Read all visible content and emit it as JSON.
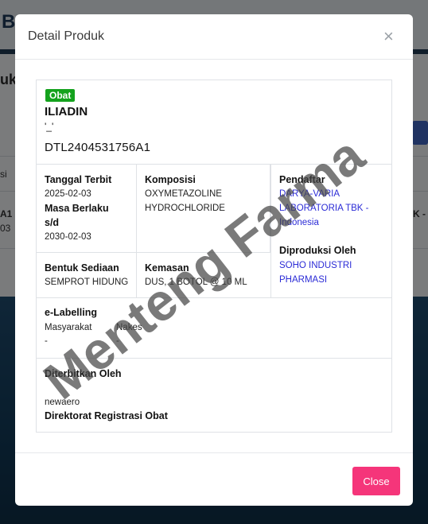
{
  "background": {
    "logo_text": "B",
    "page_title": "uk",
    "col_header": "si",
    "row_left_1": "A1",
    "row_left_2": "03",
    "row_right": "K -"
  },
  "modal": {
    "title": "Detail Produk",
    "close_icon": "close-icon",
    "badge": "Obat",
    "product_name": "ILIADIN",
    "product_sub": "'_'",
    "registration_no": "DTL2404531756A1",
    "fields": {
      "tanggal_terbit_label": "Tanggal Terbit",
      "tanggal_terbit_value": "2025-02-03",
      "masa_berlaku_label_1": "Masa Berlaku",
      "masa_berlaku_label_2": "s/d",
      "masa_berlaku_value": "2030-02-03",
      "komposisi_label": "Komposisi",
      "komposisi_value_1": "OXYMETAZOLINE",
      "komposisi_value_2": "HYDROCHLORIDE",
      "pendaftar_label": "Pendaftar",
      "pendaftar_value_1": "DARYA-VARIA",
      "pendaftar_value_2": "LABORATORIA TBK -",
      "pendaftar_value_3": "Indonesia",
      "diproduksi_label": "Diproduksi Oleh",
      "diproduksi_value_1": "SOHO INDUSTRI",
      "diproduksi_value_2": "PHARMASI",
      "bentuk_label": "Bentuk Sediaan",
      "bentuk_value": "SEMPROT HIDUNG",
      "kemasan_label": "Kemasan",
      "kemasan_value": "DUS, 1 BOTOL @ 10 ML",
      "elabel_label": "e-Labelling",
      "masyarakat_label": "Masyarakat",
      "masyarakat_value": "-",
      "nakes_label": "Nakes",
      "nakes_value": "-",
      "diterbitkan_label": "Diterbitkan Oleh",
      "diterbitkan_value": "newaero",
      "direktorat_label": "Direktorat Registrasi Obat"
    },
    "close_button_label": "Close",
    "watermark_text": "Menteng Farma",
    "colors": {
      "badge": "#14a21d",
      "link_blue": "#2b2bd6",
      "close_button": "#f5357a"
    }
  }
}
